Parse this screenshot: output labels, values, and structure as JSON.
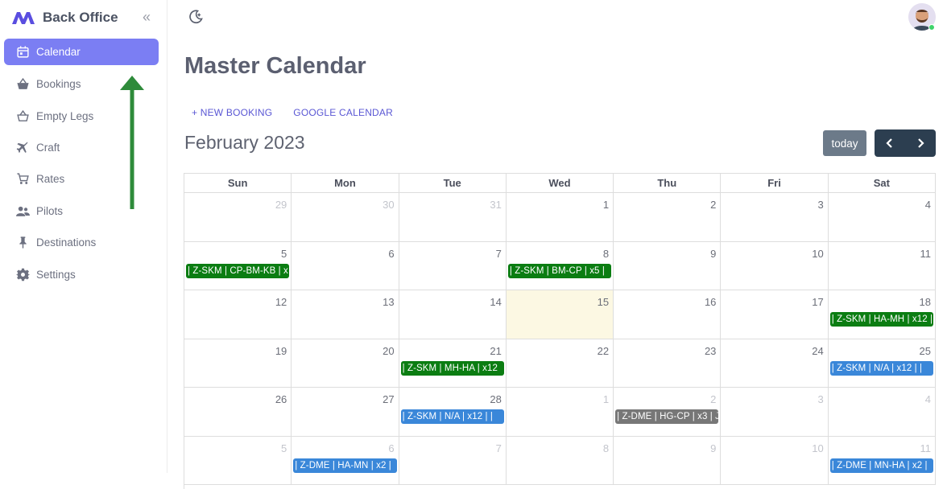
{
  "app": {
    "name": "Back Office"
  },
  "sidebar": {
    "items": [
      {
        "label": "Calendar",
        "icon": "calendar-icon",
        "active": true
      },
      {
        "label": "Bookings",
        "icon": "basket-icon"
      },
      {
        "label": "Empty Legs",
        "icon": "basket-outline-icon"
      },
      {
        "label": "Craft",
        "icon": "airplane-icon"
      },
      {
        "label": "Rates",
        "icon": "cart-icon"
      },
      {
        "label": "Pilots",
        "icon": "people-icon"
      },
      {
        "label": "Destinations",
        "icon": "pin-icon"
      },
      {
        "label": "Settings",
        "icon": "gear-icon"
      }
    ]
  },
  "page": {
    "title": "Master Calendar",
    "new_booking": "+ NEW BOOKING",
    "google_calendar": "GOOGLE CALENDAR"
  },
  "calendar": {
    "month": "February 2023",
    "today_label": "today",
    "weekdays": [
      "Sun",
      "Mon",
      "Tue",
      "Wed",
      "Thu",
      "Fri",
      "Sat"
    ],
    "weeks": [
      [
        "29",
        "30",
        "31",
        "1",
        "2",
        "3",
        "4"
      ],
      [
        "5",
        "6",
        "7",
        "8",
        "9",
        "10",
        "11"
      ],
      [
        "12",
        "13",
        "14",
        "15",
        "16",
        "17",
        "18"
      ],
      [
        "19",
        "20",
        "21",
        "22",
        "23",
        "24",
        "25"
      ],
      [
        "26",
        "27",
        "28",
        "1",
        "2",
        "3",
        "4"
      ],
      [
        "5",
        "6",
        "7",
        "8",
        "9",
        "10",
        "11"
      ]
    ],
    "events": {
      "e1": "| Z-SKM | CP-BM-KB | x",
      "e2": "| Z-SKM | BM-CP | x5 |",
      "e3": "| Z-SKM | HA-MH | x12 |",
      "e4": "| Z-SKM | MH-HA | x12",
      "e5": "| Z-SKM | N/A | x12 | |",
      "e6": "| Z-SKM | N/A | x12 | |",
      "e7": "| Z-DME | HG-CP | x3 | J",
      "e8": "| Z-DME | HA-MN | x2 |",
      "e9": "| Z-DME | MN-HA | x2 |"
    }
  },
  "colors": {
    "accent": "#7b7ef3",
    "event_green": "#0b7d12",
    "event_blue": "#3a87d9",
    "event_gray": "#777777",
    "today_bg": "#fcf8e3"
  }
}
